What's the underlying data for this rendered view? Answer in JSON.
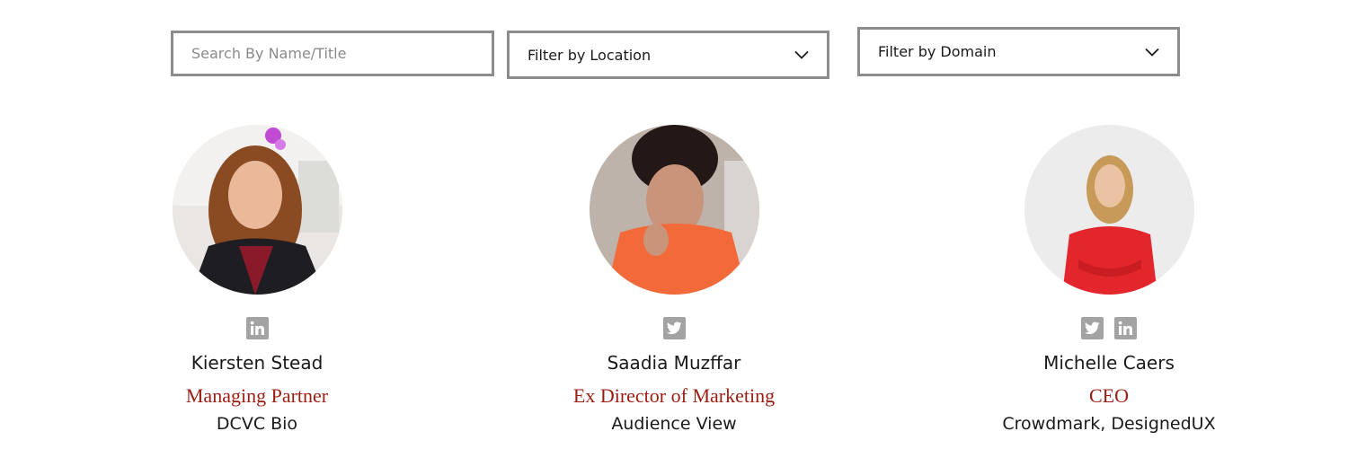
{
  "filters": {
    "search": {
      "placeholder": "Search By Name/Title",
      "value": ""
    },
    "location": {
      "label": "Filter by Location",
      "icon": "chevron-down-icon"
    },
    "domain": {
      "label": "Filter by Domain",
      "icon": "chevron-down-icon"
    }
  },
  "colors": {
    "accent": "#9b1d12",
    "social_icon": "#a3a3a3",
    "field_border": "#8c8c8c"
  },
  "people": [
    {
      "name": "Kiersten Stead",
      "title": "Managing Partner",
      "organization": "DCVC Bio",
      "socials": [
        "linkedin-icon"
      ]
    },
    {
      "name": "Saadia Muzffar",
      "title": "Ex Director of Marketing",
      "organization": "Audience View",
      "socials": [
        "twitter-icon"
      ]
    },
    {
      "name": "Michelle Caers",
      "title": "CEO",
      "organization": "Crowdmark, DesignedUX",
      "socials": [
        "twitter-icon",
        "linkedin-icon"
      ]
    }
  ]
}
